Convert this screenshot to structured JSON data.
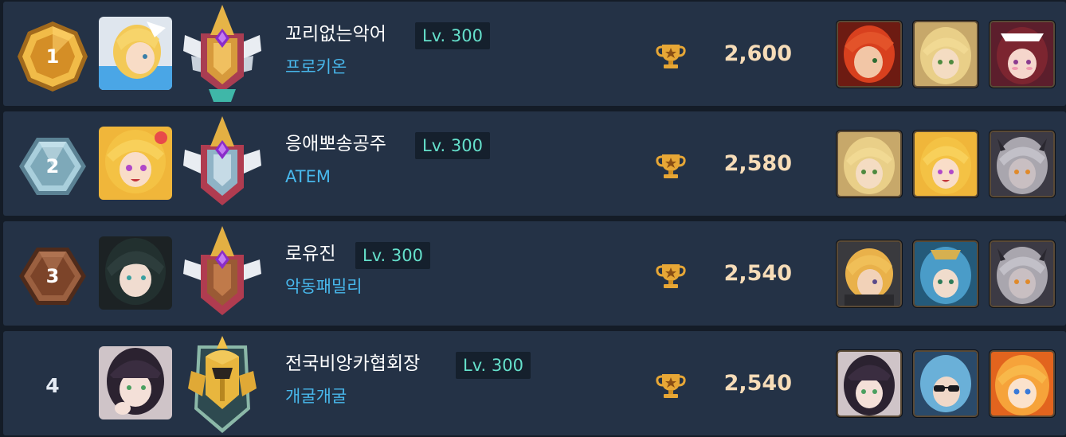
{
  "level_prefix": "Lv.",
  "colors": {
    "row_bg": "#243246",
    "gold": "#e0a43a",
    "silver": "#8fb7c7",
    "bronze": "#8a5234",
    "level_text": "#65e0cb",
    "guild_text": "#48b8ec",
    "score_text": "#f6dcb8"
  },
  "rows": [
    {
      "rank": "1",
      "rank_style": "gold",
      "avatar_icon": "blonde-character-avatar-icon",
      "emblem_icon": "gold-shield-wings-emblem-icon",
      "name": "꼬리없는악어",
      "level": "Lv. 300",
      "guild": "프로키온",
      "trophy_icon": "trophy-icon",
      "score": "2,600",
      "heroes": [
        "red-haired-hero-icon",
        "blonde-hero-icon",
        "maid-hero-icon"
      ]
    },
    {
      "rank": "2",
      "rank_style": "silver",
      "avatar_icon": "blonde-girl-avatar-icon",
      "emblem_icon": "silver-shield-wings-emblem-icon",
      "name": "응애뽀송공주",
      "level": "Lv. 300",
      "guild": "ATEM",
      "trophy_icon": "trophy-icon",
      "score": "2,580",
      "heroes": [
        "blonde-hero-icon",
        "blonde-girl-hero-icon",
        "gray-haired-hero-icon"
      ]
    },
    {
      "rank": "3",
      "rank_style": "bronze",
      "avatar_icon": "dark-haired-avatar-icon",
      "emblem_icon": "bronze-shield-wings-emblem-icon",
      "name": "로유진",
      "level": "Lv. 300",
      "guild": "악동패밀리",
      "trophy_icon": "trophy-icon",
      "score": "2,540",
      "heroes": [
        "blonde-boy-hero-icon",
        "blue-haired-hero-icon",
        "gray-haired-hero-icon"
      ]
    },
    {
      "rank": "4",
      "rank_style": "plain",
      "avatar_icon": "dark-haired-girl-avatar-icon",
      "emblem_icon": "gold-helmet-emblem-icon",
      "name": "전국비앙카협회장",
      "level": "Lv. 300",
      "guild": "개굴개굴",
      "trophy_icon": "trophy-icon",
      "score": "2,540",
      "heroes": [
        "dark-haired-girl-hero-icon",
        "sunglasses-hero-icon",
        "orange-haired-hero-icon"
      ]
    }
  ]
}
